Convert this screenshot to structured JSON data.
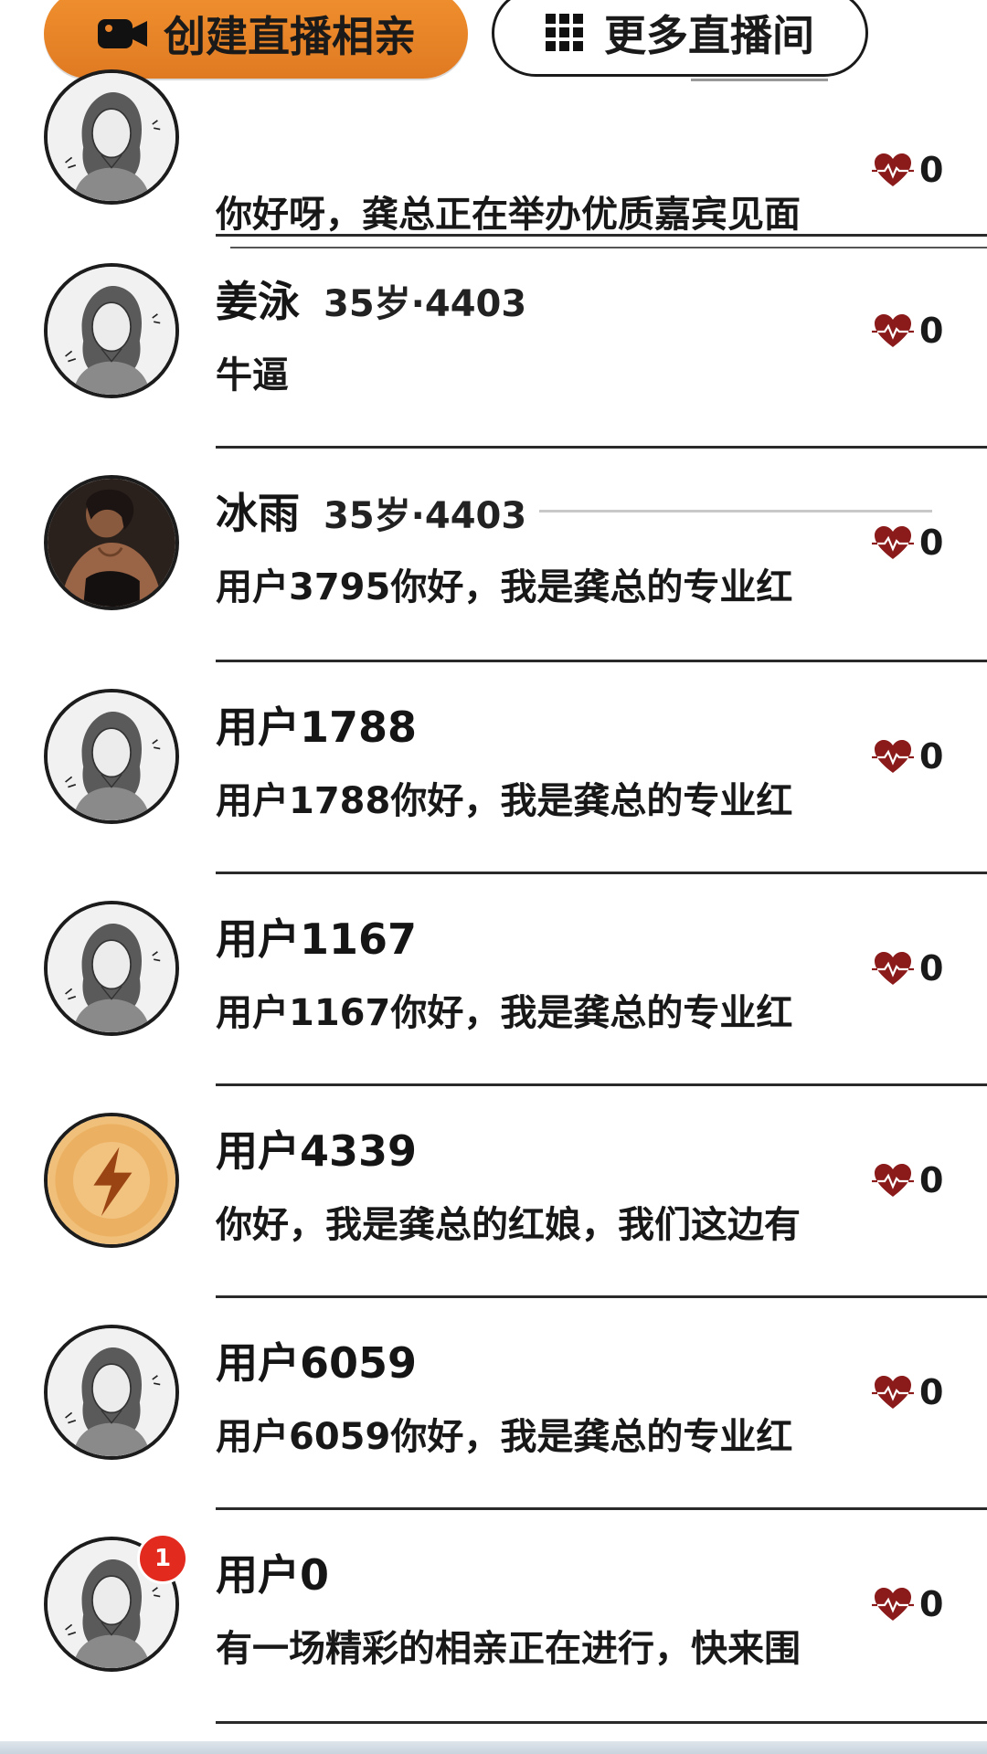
{
  "top_actions": {
    "create_label": "创建直播相亲",
    "more_label": "更多直播间"
  },
  "colors": {
    "accent": "#e8832a",
    "heart": "#8b1a1a",
    "badge": "#e22a1f"
  },
  "rows": [
    {
      "name": "",
      "meta": "",
      "message": "你好呀，龚总正在举办优质嘉宾见面",
      "likes": "0",
      "avatar": "sketch-woman",
      "badge": ""
    },
    {
      "name": "姜泳",
      "meta": "35岁·4403",
      "message": "牛逼",
      "likes": "0",
      "avatar": "sketch-woman",
      "badge": ""
    },
    {
      "name": "冰雨",
      "meta": "35岁·4403",
      "message": "用户3795你好，我是龚总的专业红",
      "likes": "0",
      "avatar": "photo-woman",
      "badge": ""
    },
    {
      "name": "用户1788",
      "meta": "",
      "message": "用户1788你好，我是龚总的专业红",
      "likes": "0",
      "avatar": "sketch-woman",
      "badge": ""
    },
    {
      "name": "用户1167",
      "meta": "",
      "message": "用户1167你好，我是龚总的专业红",
      "likes": "0",
      "avatar": "sketch-woman",
      "badge": ""
    },
    {
      "name": "用户4339",
      "meta": "",
      "message": "你好，我是龚总的红娘，我们这边有",
      "likes": "0",
      "avatar": "lightning",
      "badge": ""
    },
    {
      "name": "用户6059",
      "meta": "",
      "message": "用户6059你好，我是龚总的专业红",
      "likes": "0",
      "avatar": "sketch-woman",
      "badge": ""
    },
    {
      "name": "用户0",
      "meta": "",
      "message": "有一场精彩的相亲正在进行，快来围",
      "likes": "0",
      "avatar": "sketch-woman",
      "badge": "1"
    }
  ]
}
